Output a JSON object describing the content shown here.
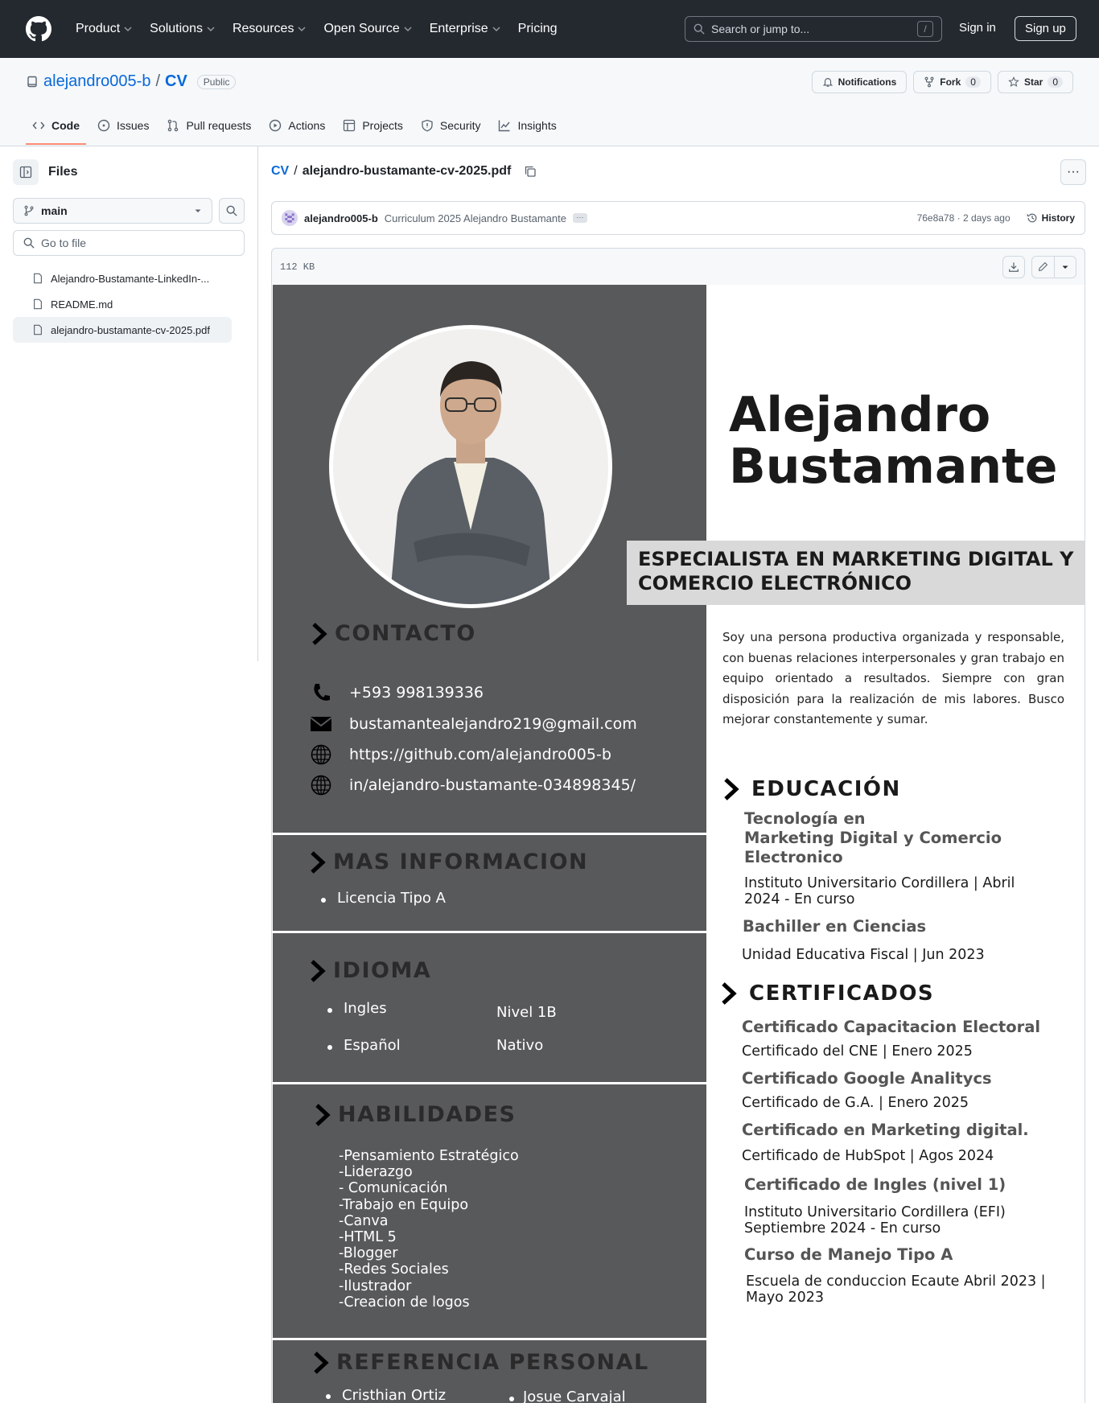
{
  "header": {
    "nav": [
      "Product",
      "Solutions",
      "Resources",
      "Open Source",
      "Enterprise",
      "Pricing"
    ],
    "search_placeholder": "Search or jump to...",
    "search_key": "/",
    "sign_in": "Sign in",
    "sign_up": "Sign up"
  },
  "repo": {
    "owner": "alejandro005-b",
    "separator": "/",
    "name": "CV",
    "visibility": "Public",
    "notifications": "Notifications",
    "fork": "Fork",
    "fork_count": "0",
    "star": "Star",
    "star_count": "0",
    "tabs": [
      "Code",
      "Issues",
      "Pull requests",
      "Actions",
      "Projects",
      "Security",
      "Insights"
    ]
  },
  "sidebar": {
    "title": "Files",
    "branch": "main",
    "goto_placeholder": "Go to file",
    "files": [
      "Alejandro-Bustamante-LinkedIn-...",
      "README.md",
      "alejandro-bustamante-cv-2025.pdf"
    ]
  },
  "file": {
    "crumb_root": "CV",
    "crumb_sep": "/",
    "crumb_file": "alejandro-bustamante-cv-2025.pdf",
    "more": "···",
    "commit_author": "alejandro005-b",
    "commit_message": "Curriculum 2025 Alejandro Bustamante",
    "commit_dots": "···",
    "commit_meta": "76e8a78 · 2 days ago",
    "history": "History",
    "size": "112 KB"
  },
  "cv": {
    "name_line1": "Alejandro",
    "name_line2": "Bustamante",
    "role_line1": "ESPECIALISTA EN MARKETING DIGITAL Y",
    "role_line2": "COMERCIO ELECTRÓNICO",
    "summary": "Soy una persona productiva organizada y responsable, con buenas relaciones interpersonales y gran trabajo en equipo orientado a resultados. Siempre con gran disposición para la realización de mis labores. Busco mejorar constantemente y sumar.",
    "contacto_title": "CONTACTO",
    "phone": "+593  998139336",
    "email": "bustamantealejandro219@gmail.com",
    "github": "https://github.com/alejandro005-b",
    "linkedin": "in/alejandro-bustamante-034898345/",
    "mas_title": "MAS INFORMACION",
    "mas_item": "Licencia Tipo A",
    "idioma_title": "IDIOMA",
    "lang1": "Ingles",
    "lang1_level": "Nivel 1B",
    "lang2": "Español",
    "lang2_level": "Nativo",
    "habilidades_title": "HABILIDADES",
    "skills": [
      "-Pensamiento Estratégico",
      "-Liderazgo",
      "- Comunicación",
      "-Trabajo en Equipo",
      "-Canva",
      "-HTML 5",
      "-Blogger",
      "-Redes Sociales",
      "-Ilustrador",
      "-Creacion de logos"
    ],
    "referencia_title": "REFERENCIA PERSONAL",
    "ref1": "Cristhian Ortiz",
    "ref2": "Josue Carvajal",
    "educacion_title": "EDUCACIÓN",
    "edu1_title_l1": "Tecnología en",
    "edu1_title_l2": "Marketing Digital y Comercio",
    "edu1_title_l3": "Electronico",
    "edu1_sub_l1": "Instituto Universitario Cordillera | Abril",
    "edu1_sub_l2": "2024 - En curso",
    "edu2_title": "Bachiller en Ciencias",
    "edu2_sub": "Unidad Educativa Fiscal  | Jun 2023",
    "certificados_title": "CERTIFICADOS",
    "cert1_title": "Certificado Capacitacion Electoral",
    "cert1_sub": "Certificado del CNE | Enero 2025",
    "cert2_title": "Certificado Google Analitycs",
    "cert2_sub": "Certificado de G.A. | Enero 2025",
    "cert3_title": "Certificado en Marketing digital.",
    "cert3_sub": "Certificado de HubSpot | Agos 2024",
    "cert4_title": "Certificado de Ingles (nivel 1)",
    "cert4_sub_l1": "Instituto Universitario Cordillera (EFI)",
    "cert4_sub_l2": "Septiembre 2024 - En curso",
    "cert5_title": "Curso de Manejo Tipo A",
    "cert5_sub_l1": "Escuela de conduccion Ecaute Abril 2023 |",
    "cert5_sub_l2": "Mayo 2023"
  }
}
